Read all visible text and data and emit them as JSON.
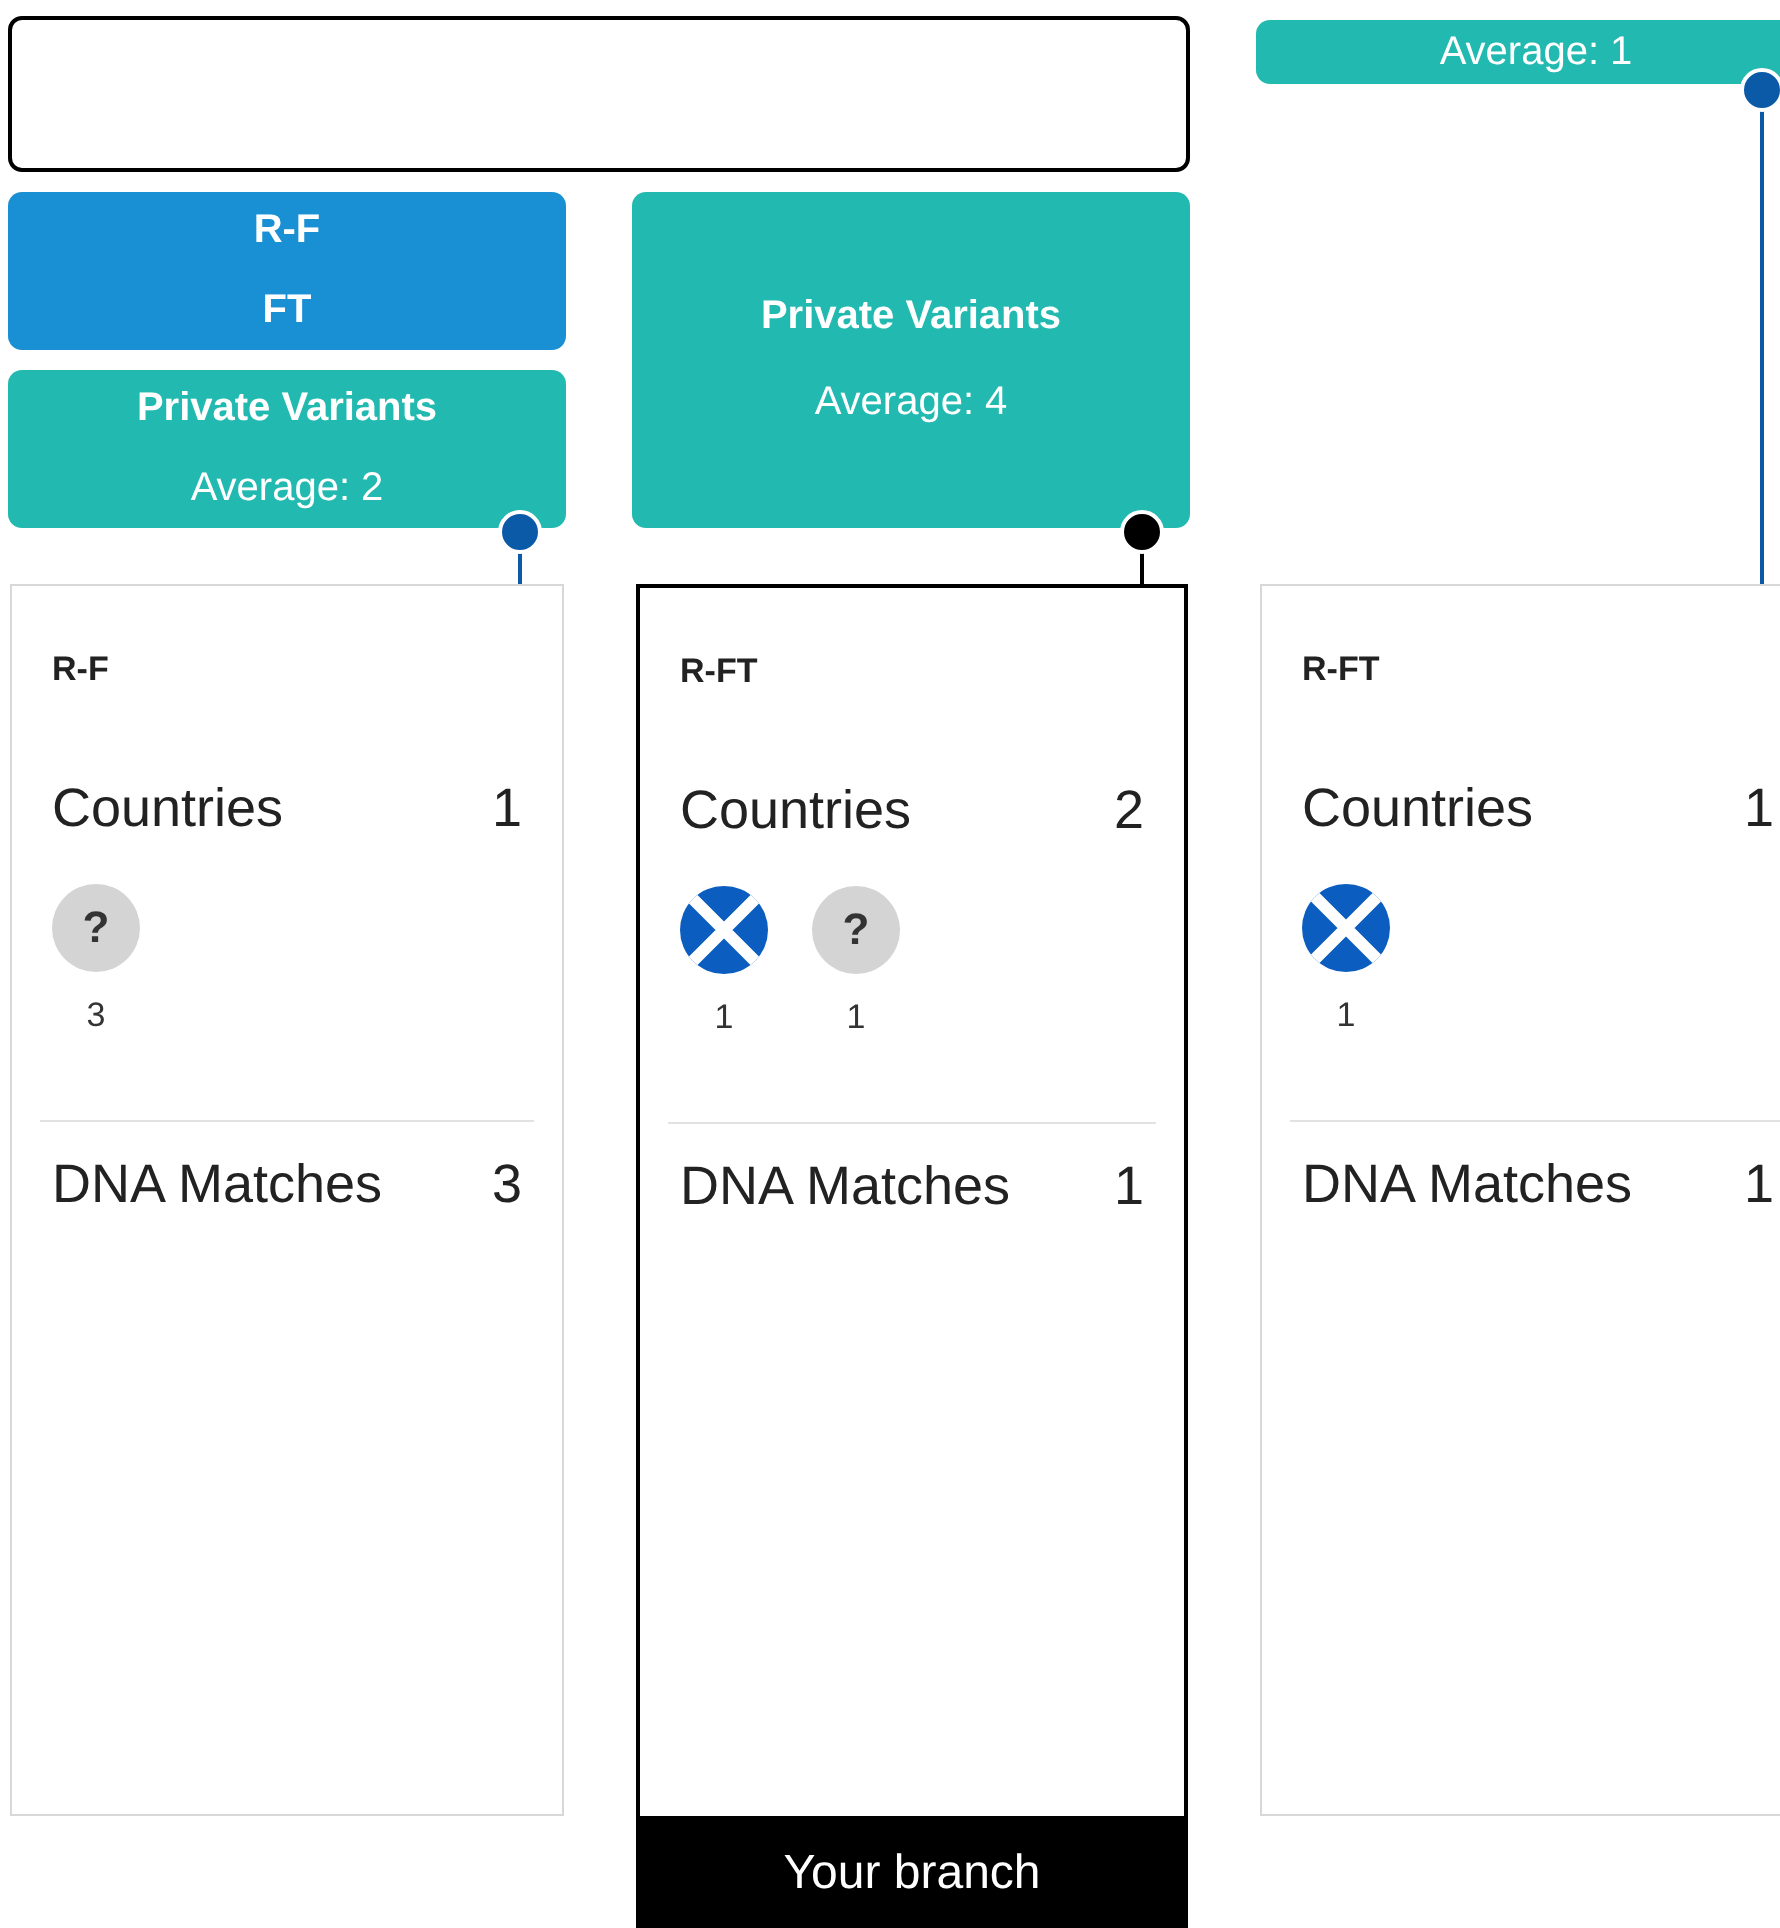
{
  "branches": [
    {
      "selected": false,
      "header": {
        "lines": [
          "R-F",
          "FT"
        ]
      },
      "variants": {
        "title": "Private Variants",
        "average": "Average: 2"
      },
      "card": {
        "title": "R-F",
        "countries_label": "Countries",
        "countries_count": "1",
        "countries": [
          {
            "kind": "unknown",
            "symbol": "?",
            "count": "3"
          }
        ],
        "matches_label": "DNA Matches",
        "matches_count": "3"
      }
    },
    {
      "selected": true,
      "variants": {
        "title": "Private Variants",
        "average": "Average: 4"
      },
      "card": {
        "title": "R-FT",
        "countries_label": "Countries",
        "countries_count": "2",
        "countries": [
          {
            "kind": "flag",
            "count": "1"
          },
          {
            "kind": "unknown",
            "symbol": "?",
            "count": "1"
          }
        ],
        "matches_label": "DNA Matches",
        "matches_count": "1"
      },
      "footer": "Your branch"
    },
    {
      "selected": false,
      "variants": {
        "average": "Average: 1"
      },
      "card": {
        "title": "R-FT",
        "countries_label": "Countries",
        "countries_count": "1",
        "countries": [
          {
            "kind": "flag",
            "count": "1"
          }
        ],
        "matches_label": "DNA Matches",
        "matches_count": "1"
      }
    }
  ]
}
